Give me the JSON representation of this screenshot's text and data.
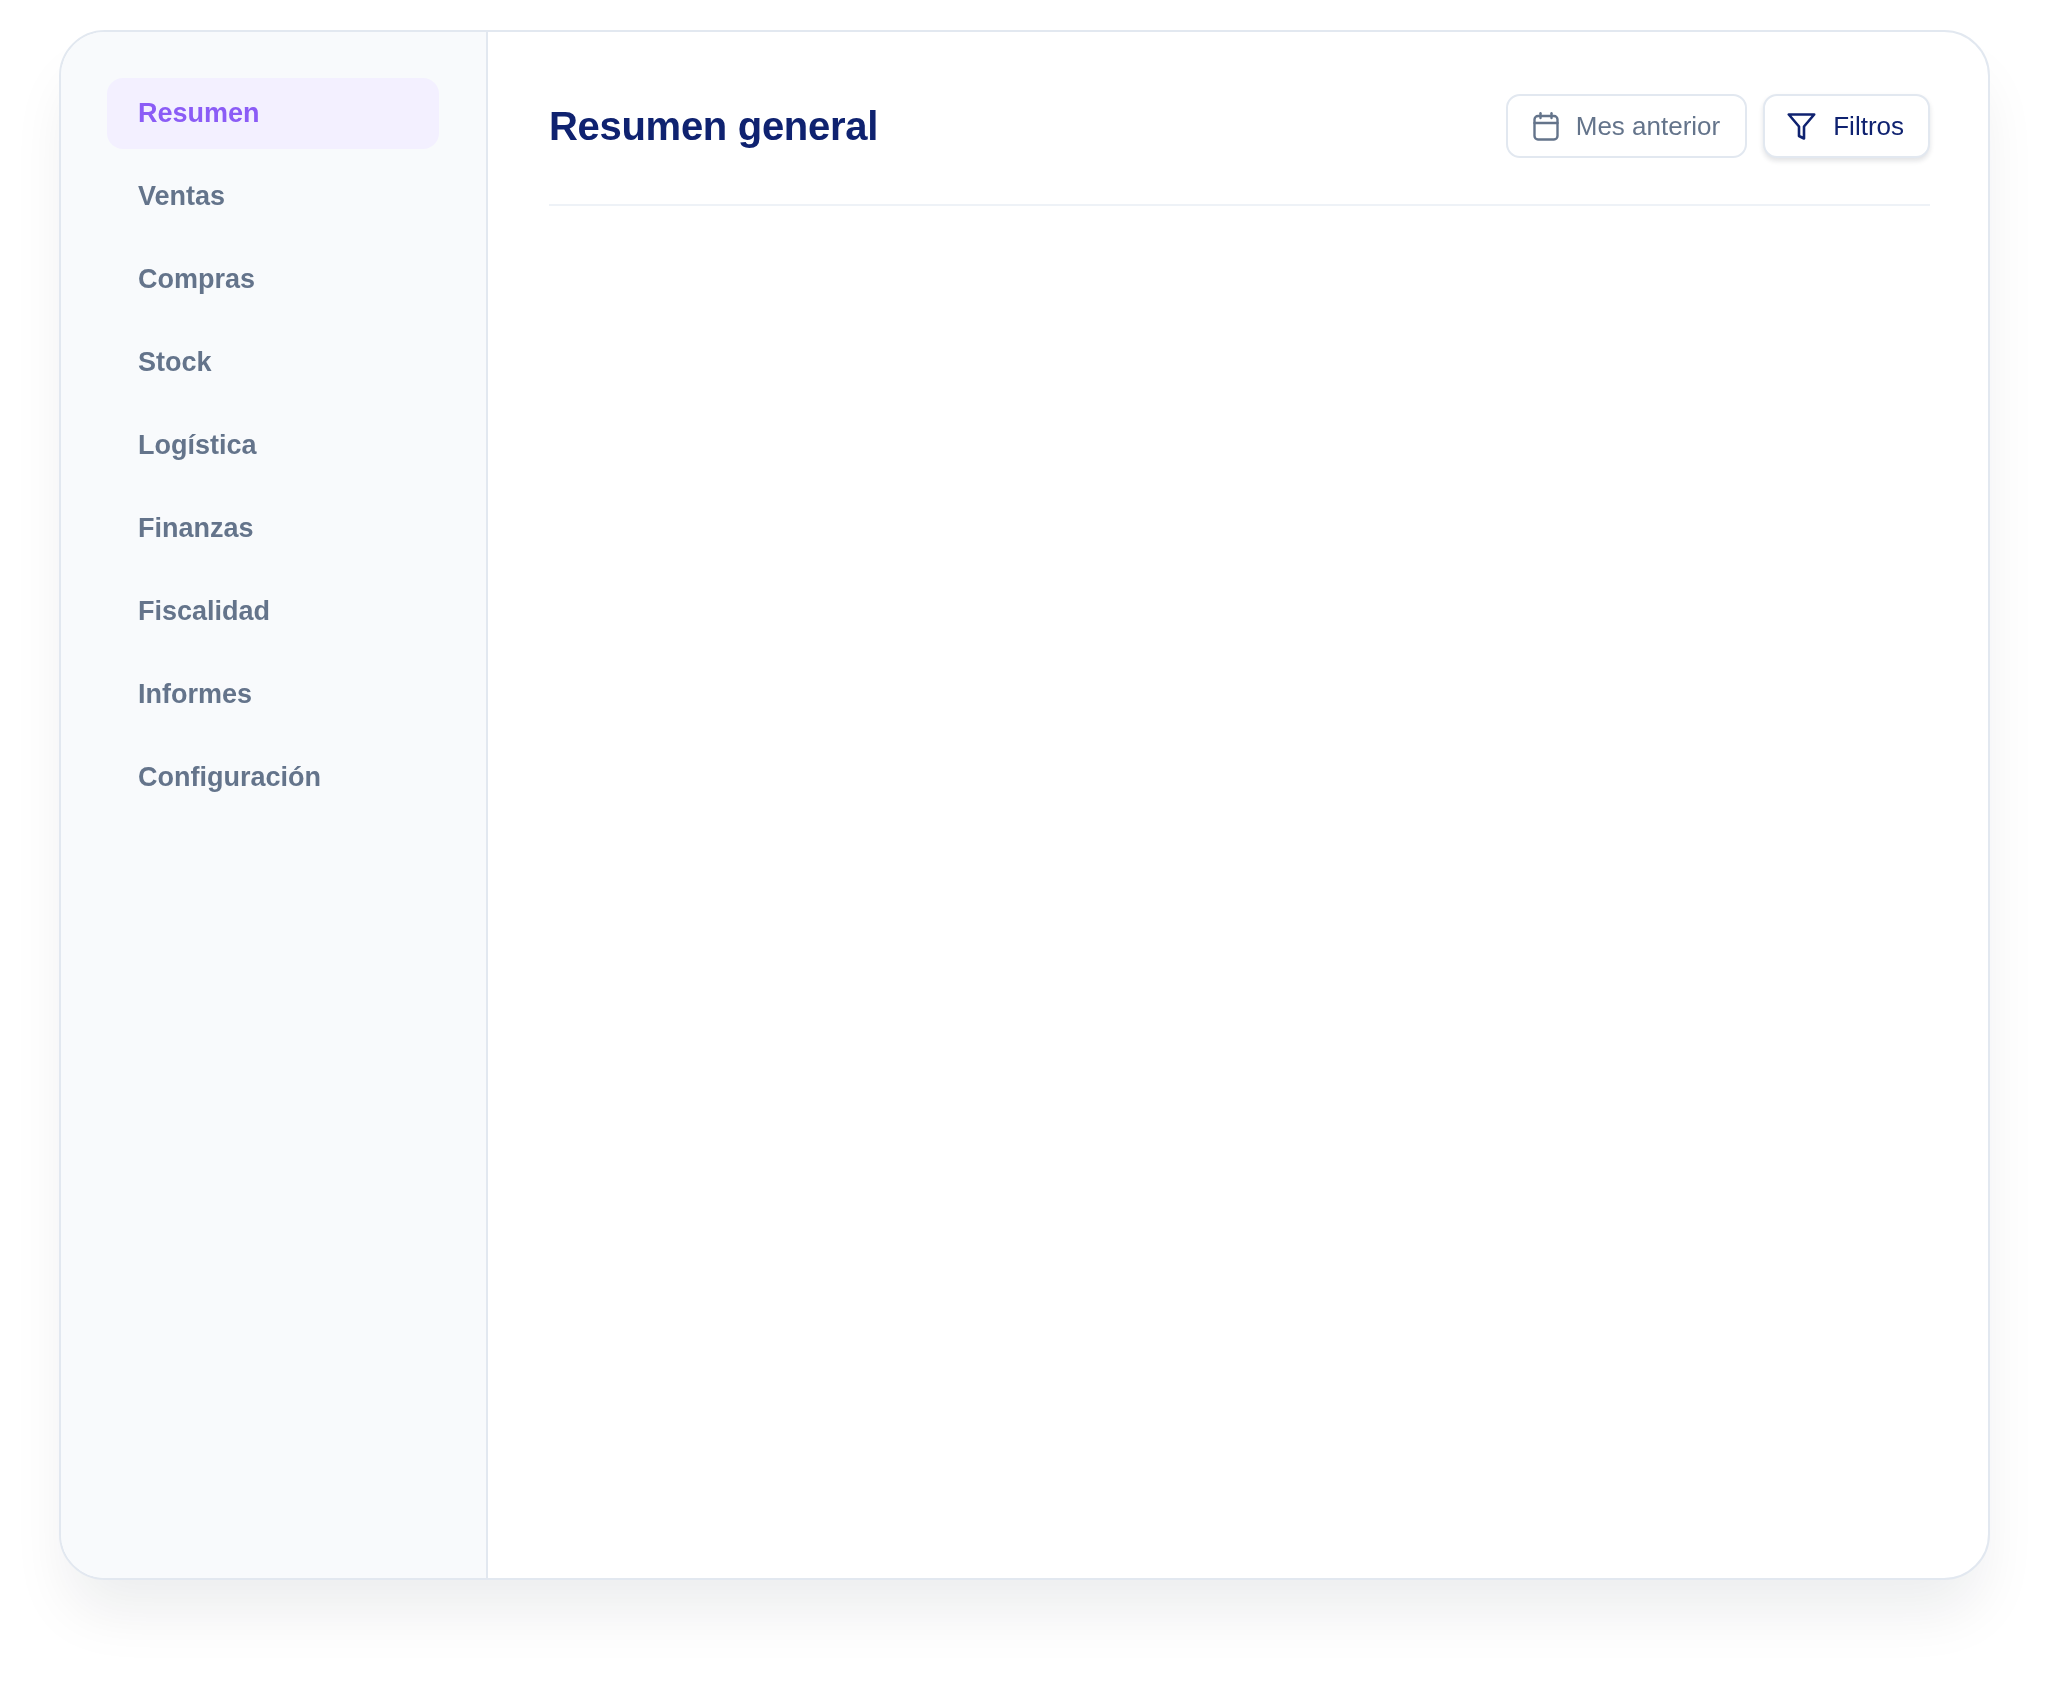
{
  "sidebar": {
    "items": [
      {
        "label": "Resumen",
        "selected": true
      },
      {
        "label": "Ventas",
        "selected": false
      },
      {
        "label": "Compras",
        "selected": false
      },
      {
        "label": "Stock",
        "selected": false
      },
      {
        "label": "Logística",
        "selected": false
      },
      {
        "label": "Finanzas",
        "selected": false
      },
      {
        "label": "Fiscalidad",
        "selected": false
      },
      {
        "label": "Informes",
        "selected": false
      },
      {
        "label": "Configuración",
        "selected": false
      }
    ]
  },
  "header": {
    "title": "Resumen general",
    "buttons": [
      {
        "label": "Mes anterior",
        "kind": "date"
      },
      {
        "label": "Filtros",
        "kind": "filter"
      }
    ]
  }
}
